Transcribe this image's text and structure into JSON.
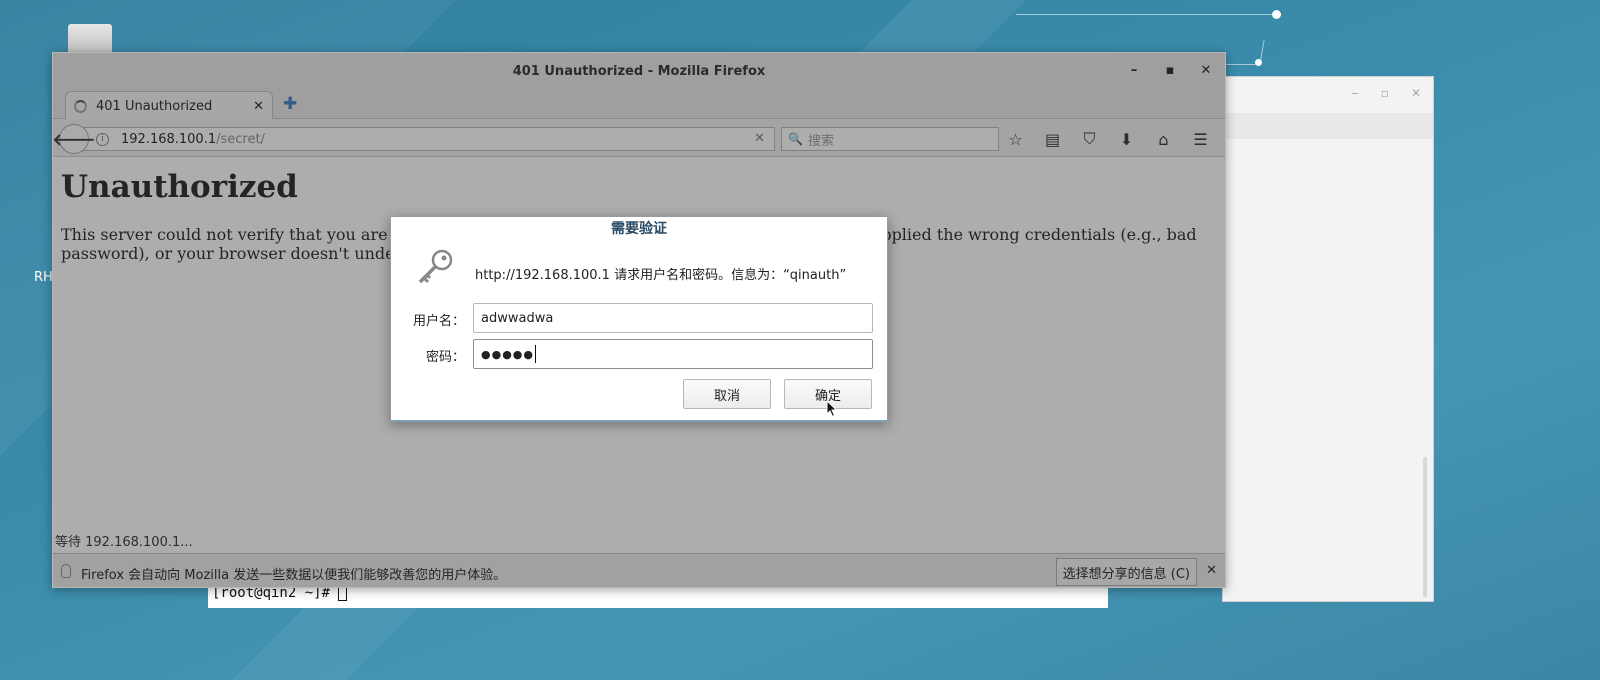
{
  "desktop": {
    "icon_label": "RH"
  },
  "terminal": {
    "prompt": "[root@qin2 ~]# "
  },
  "browser": {
    "window_title": "401 Unauthorized - Mozilla Firefox",
    "tab_title": "401 Unauthorized",
    "url_host": "192.168.100.1",
    "url_path": "/secret/",
    "search_placeholder": "搜索",
    "page": {
      "heading": "Unauthorized",
      "body": "This server could not verify that you are authorized to access the document requested. Either you supplied the wrong credentials (e.g., bad password), or your browser doesn't understand how to supply the credentials required."
    },
    "status_text": "等待 192.168.100.1...",
    "notification": {
      "text": "Firefox 会自动向 Mozilla 发送一些数据以便我们能够改善您的用户体验。",
      "button_label": "选择想分享的信息 (C)"
    }
  },
  "auth_dialog": {
    "title": "需要验证",
    "message": "http://192.168.100.1 请求用户名和密码。信息为：“qinauth”",
    "username_label": "用户名：",
    "username_value": "adwwadwa",
    "password_label": "密码：",
    "password_mask": "●●●●●",
    "cancel_label": "取消",
    "ok_label": "确定"
  }
}
